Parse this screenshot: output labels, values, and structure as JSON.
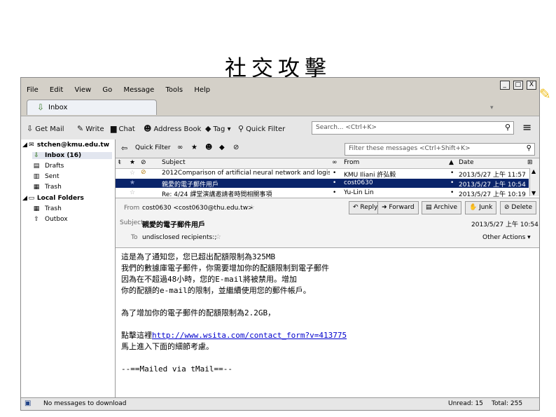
{
  "slide": {
    "title": "社交攻擊"
  },
  "window": {
    "menu": [
      "File",
      "Edit",
      "View",
      "Go",
      "Message",
      "Tools",
      "Help"
    ],
    "controls": {
      "minimize": "_",
      "maximize": "□",
      "close": "X"
    },
    "tab": {
      "label": "Inbox"
    }
  },
  "toolbar": {
    "get_mail": "Get Mail",
    "write": "Write",
    "chat": "Chat",
    "address_book": "Address Book",
    "tag": "Tag",
    "quick_filter": "Quick Filter",
    "search_placeholder": "Search... <Ctrl+K>"
  },
  "folders": {
    "account": "stchen@kmu.edu.tw",
    "account_items": [
      {
        "label": "Inbox (16)",
        "icon": "inbox-icon"
      },
      {
        "label": "Drafts",
        "icon": "drafts-icon"
      },
      {
        "label": "Sent",
        "icon": "sent-icon"
      },
      {
        "label": "Trash",
        "icon": "trash-icon"
      }
    ],
    "local": "Local Folders",
    "local_items": [
      {
        "label": "Trash",
        "icon": "trash-icon"
      },
      {
        "label": "Outbox",
        "icon": "outbox-icon"
      }
    ]
  },
  "message_list": {
    "quick_filter_label": "Quick Filter",
    "filter_placeholder": "Filter these messages <Ctrl+Shift+K>",
    "columns": {
      "subject": "Subject",
      "from": "From",
      "date": "Date"
    },
    "rows": [
      {
        "subject": "2012Comparison of artificial neural network and logistic ...",
        "from": "KMU Iliani 許弘毅",
        "date": "2013/5/27 上午 11:57",
        "selected": false
      },
      {
        "subject": "親愛的電子郵件用戶",
        "from": "cost0630",
        "date": "2013/5/27 上午 10:54",
        "selected": true
      },
      {
        "subject": "Re: 4/24 課堂演講邀請者時間相關事項",
        "from": "Yu-Lin Lin",
        "date": "2013/5/27 上午 10:19",
        "selected": false
      }
    ]
  },
  "message_header": {
    "from_label": "From",
    "from_value": "cost0630 <cost0630@thu.edu.tw>",
    "subject_label": "Subject",
    "subject_value": "親愛的電子郵件用戶",
    "to_label": "To",
    "to_value": "undisclosed recipients:;",
    "date": "2013/5/27 上午 10:54",
    "other_actions": "Other Actions",
    "buttons": {
      "reply": "Reply",
      "forward": "Forward",
      "archive": "Archive",
      "junk": "Junk",
      "delete": "Delete"
    }
  },
  "message_body": {
    "line1": "這是為了通知您，您已超出配額限制為325MB",
    "line2": "我們的數據庫電子郵件，你需要增加你的配額限制到電子郵件",
    "line3": "因為在不超過48小時，您的E-mail將被禁用。增加",
    "line4": "你的配額的e-mail的限制，並繼續使用您的郵件帳戶。",
    "line5": "為了增加你的電子郵件的配額限制為2.2GB，",
    "line6_prefix": "點擊這裡",
    "link": "http://www.wsita.com/contact_form?v=413775",
    "line7": "馬上進入下面的細節考慮。",
    "signature": "--==Mailed via tMail==--"
  },
  "status": {
    "message": "No messages to download",
    "unread": "Unread: 15",
    "total": "Total: 255"
  }
}
